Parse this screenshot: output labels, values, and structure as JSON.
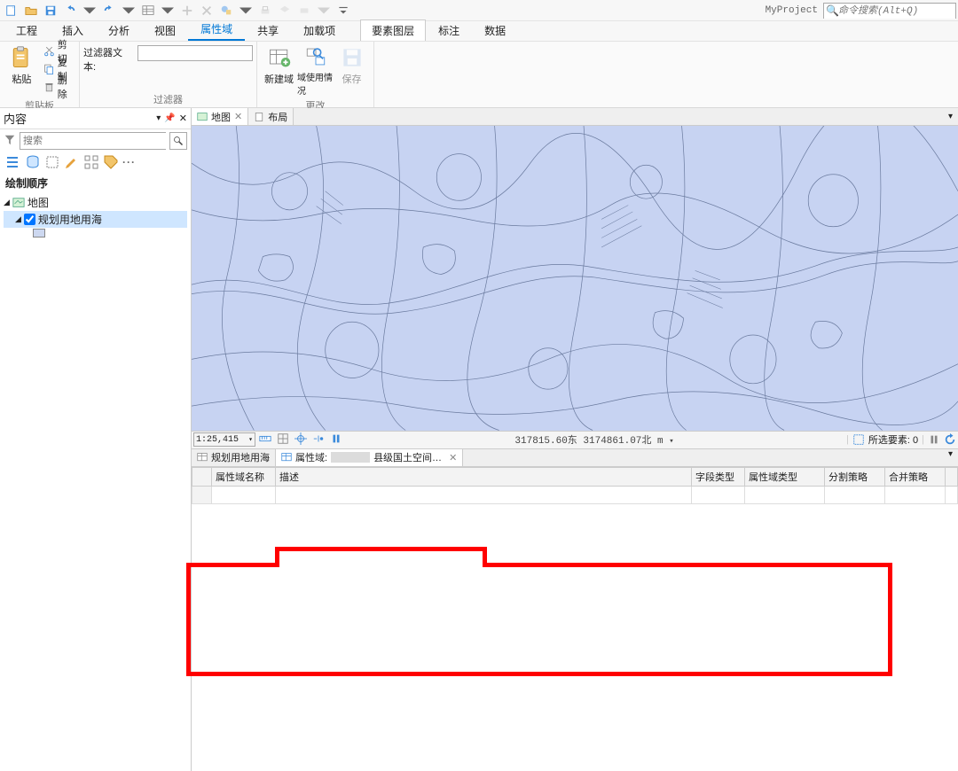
{
  "project_name": "MyProject",
  "command_search_placeholder": "命令搜索(Alt+Q)",
  "ribbon_tabs": {
    "project": "工程",
    "insert": "插入",
    "analysis": "分析",
    "view": "视图",
    "domain": "属性域",
    "share": "共享",
    "addin": "加载项",
    "ctx_featurelayer": "要素图层",
    "ctx_annotate": "标注",
    "ctx_data": "数据"
  },
  "ribbon": {
    "clipboard": {
      "paste": "粘贴",
      "cut": "剪切",
      "copy": "复制",
      "delete": "删除",
      "title": "剪贴板"
    },
    "filter": {
      "label": "过滤器文本:",
      "filter_text": "",
      "title": "过滤器"
    },
    "manage": {
      "new_domain": "新建域",
      "domain_usage": "域使用情况",
      "save": "保存",
      "title": "更改"
    }
  },
  "contents_panel": {
    "title": "内容",
    "search_placeholder": "搜索",
    "section_drawing_order": "绘制顺序",
    "root_map": "地图",
    "layer_land_use": "规划用地用海"
  },
  "view_tabs": {
    "map": "地图",
    "layout": "布局"
  },
  "status": {
    "scale": "1:25,415",
    "coords": "317815.60东 3174861.07北 m",
    "selected": "所选要素: 0"
  },
  "lower_tabs": {
    "land_use": "规划用地用海",
    "domain_prefix": "属性域:",
    "domain_suffix": "县级国土空间…"
  },
  "domain_grid": {
    "col_name": "属性域名称",
    "col_desc": "描述",
    "col_fieldtype": "字段类型",
    "col_domaintype": "属性域类型",
    "col_split": "分割策略",
    "col_merge": "合并策略"
  }
}
